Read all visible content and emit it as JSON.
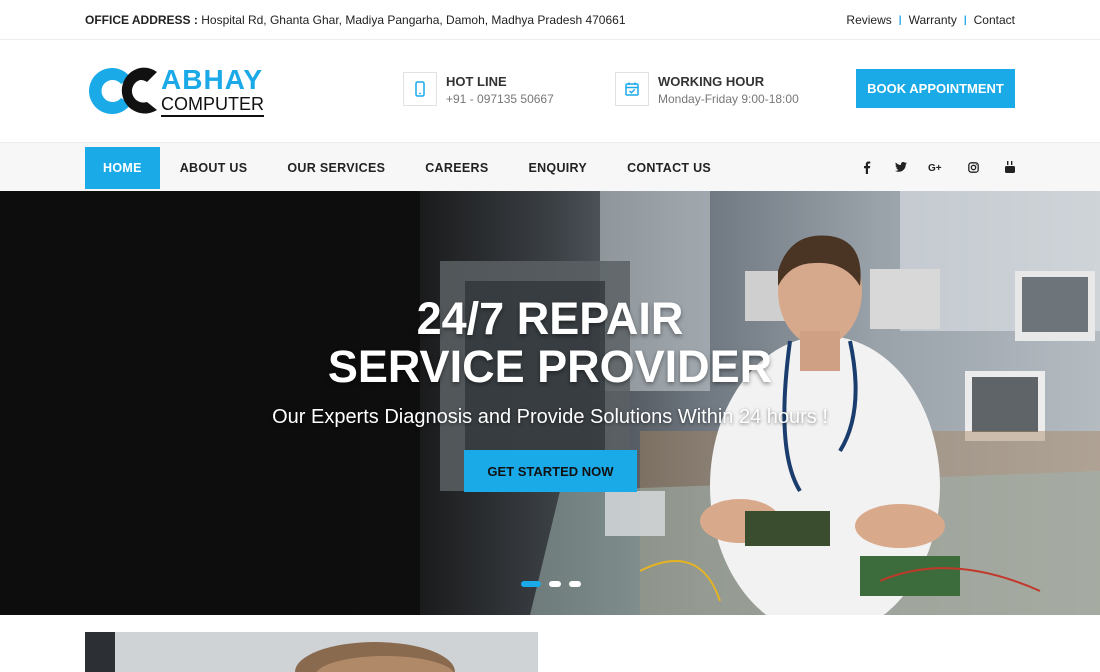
{
  "topbar": {
    "address_label": "OFFICE ADDRESS :",
    "address": "Hospital Rd, Ghanta Ghar, Madiya Pangarha, Damoh, Madhya Pradesh 470661",
    "links": [
      "Reviews",
      "Warranty",
      "Contact"
    ],
    "separator": "|"
  },
  "header": {
    "logo_line1": "ABHAY",
    "logo_line2": "COMPUTER",
    "hotline_title": "HOT LINE",
    "hotline_value": "+91 - 097135 50667",
    "hours_title": "WORKING HOUR",
    "hours_value": "Monday-Friday 9:00-18:00",
    "book_label": "BOOK APPOINTMENT",
    "icons": [
      "phone-icon",
      "calendar-check-icon"
    ]
  },
  "nav": {
    "items": [
      "HOME",
      "ABOUT US",
      "OUR SERVICES",
      "CAREERS",
      "ENQUIRY",
      "CONTACT US"
    ],
    "active": "HOME",
    "social": [
      {
        "name": "facebook-icon",
        "glyph": "f"
      },
      {
        "name": "twitter-icon",
        "glyph": "t"
      },
      {
        "name": "google-plus-icon",
        "glyph": "G+"
      },
      {
        "name": "instagram-icon",
        "glyph": "◎"
      },
      {
        "name": "youtube-icon",
        "glyph": "▶"
      }
    ]
  },
  "hero": {
    "title_line1": "24/7 REPAIR",
    "title_line2": "SERVICE PROVIDER",
    "subtitle": "Our Experts Diagnosis and Provide Solutions Within 24 hours !",
    "cta_label": "GET STARTED NOW",
    "slide_count": 3,
    "active_slide": 1
  },
  "colors": {
    "accent": "#1aaae8",
    "dark": "#111111",
    "text": "#222222",
    "muted": "#777777"
  }
}
